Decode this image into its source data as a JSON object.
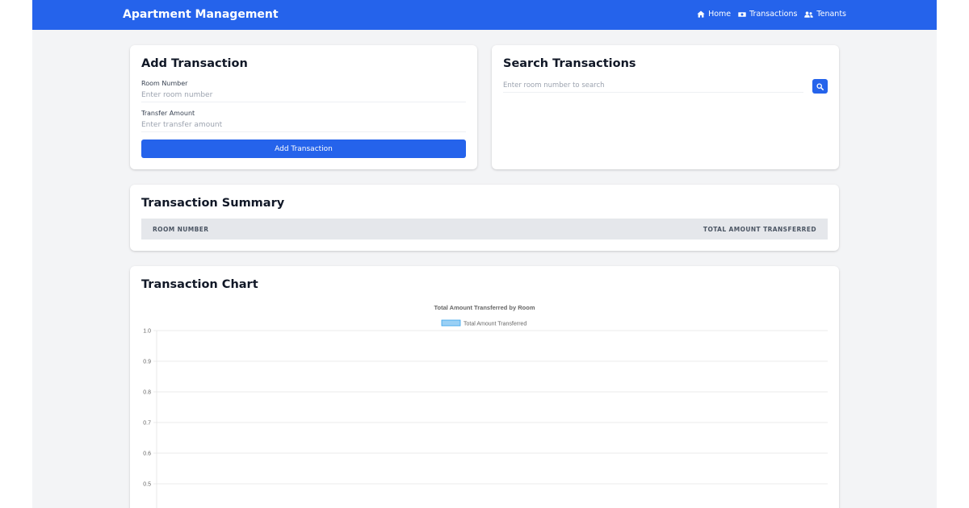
{
  "navbar": {
    "brand": "Apartment Management",
    "links": [
      {
        "label": "Home",
        "icon": "home-icon"
      },
      {
        "label": "Transactions",
        "icon": "money-bill-icon"
      },
      {
        "label": "Tenants",
        "icon": "users-icon"
      }
    ]
  },
  "add_form": {
    "title": "Add Transaction",
    "room_label": "Room Number",
    "room_placeholder": "Enter room number",
    "amount_label": "Transfer Amount",
    "amount_placeholder": "Enter transfer amount",
    "submit_label": "Add Transaction"
  },
  "search": {
    "title": "Search Transactions",
    "placeholder": "Enter room number to search",
    "button_icon": "search-icon"
  },
  "summary": {
    "title": "Transaction Summary",
    "columns": [
      "ROOM NUMBER",
      "TOTAL AMOUNT TRANSFERRED"
    ],
    "rows": []
  },
  "chart": {
    "title": "Transaction Chart"
  },
  "colors": {
    "primary": "#2563eb",
    "background": "#f3f4f6",
    "legend_fill": "#9ad0f5",
    "legend_stroke": "#36a2eb"
  },
  "chart_data": {
    "type": "bar",
    "title": "Total Amount Transferred by Room",
    "categories": [],
    "series": [
      {
        "name": "Total Amount Transferred",
        "values": []
      }
    ],
    "y_ticks": [
      "1.0",
      "0.9",
      "0.8",
      "0.7",
      "0.6",
      "0.5"
    ],
    "ylim": [
      0.5,
      1.0
    ],
    "grid": true,
    "legend": "top"
  }
}
